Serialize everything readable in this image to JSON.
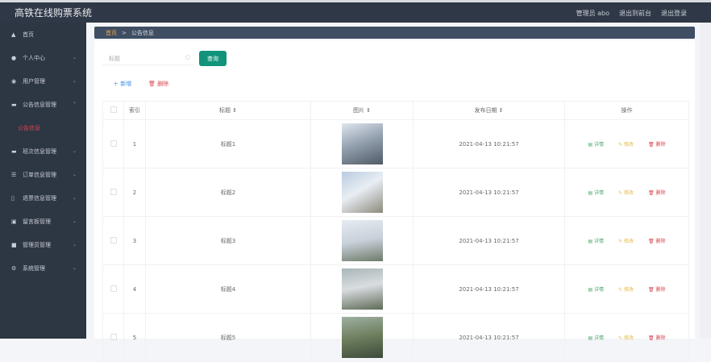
{
  "header": {
    "title": "高铁在线购票系统",
    "user": "管理员 abo",
    "to_front": "退出到前台",
    "logout": "退出登录"
  },
  "sidebar": {
    "items": [
      {
        "label": "首页",
        "icon": "home-icon",
        "chev": ""
      },
      {
        "label": "个人中心",
        "icon": "user-icon",
        "chev": "⌄"
      },
      {
        "label": "用户管理",
        "icon": "mic-icon",
        "chev": "⌄"
      },
      {
        "label": "公告信息管理",
        "icon": "monitor-icon",
        "chev": "⌃"
      },
      {
        "label": "班次信息管理",
        "icon": "monitor-icon",
        "chev": "⌄"
      },
      {
        "label": "订单信息管理",
        "icon": "list-icon",
        "chev": "⌄"
      },
      {
        "label": "退票信息管理",
        "icon": "phone-icon",
        "chev": "⌄"
      },
      {
        "label": "留言板管理",
        "icon": "clipboard-icon",
        "chev": "⌄"
      },
      {
        "label": "管理员管理",
        "icon": "image-icon",
        "chev": "⌄"
      },
      {
        "label": "系统管理",
        "icon": "gear-icon",
        "chev": "⌄"
      }
    ],
    "sub_item": "公告信息"
  },
  "breadcrumb": {
    "home": "首页",
    "sep": ">",
    "current": "公告信息"
  },
  "search": {
    "placeholder": "标题",
    "button": "查询"
  },
  "actions": {
    "add": "新增",
    "delete": "删除"
  },
  "table": {
    "headers": [
      "索引",
      "标题 ⇕",
      "图片 ⇕",
      "发布日期 ⇕",
      "操作"
    ],
    "rows": [
      {
        "index": "1",
        "title": "标题1",
        "date": "2021-04-13 10:21:57"
      },
      {
        "index": "2",
        "title": "标题2",
        "date": "2021-04-13 10:21:57"
      },
      {
        "index": "3",
        "title": "标题3",
        "date": "2021-04-13 10:21:57"
      },
      {
        "index": "4",
        "title": "标题4",
        "date": "2021-04-13 10:21:57"
      },
      {
        "index": "5",
        "title": "标题5",
        "date": "2021-04-13 10:21:57"
      }
    ],
    "row_actions": {
      "detail": "详情",
      "edit": "修改",
      "delete": "删除"
    }
  }
}
